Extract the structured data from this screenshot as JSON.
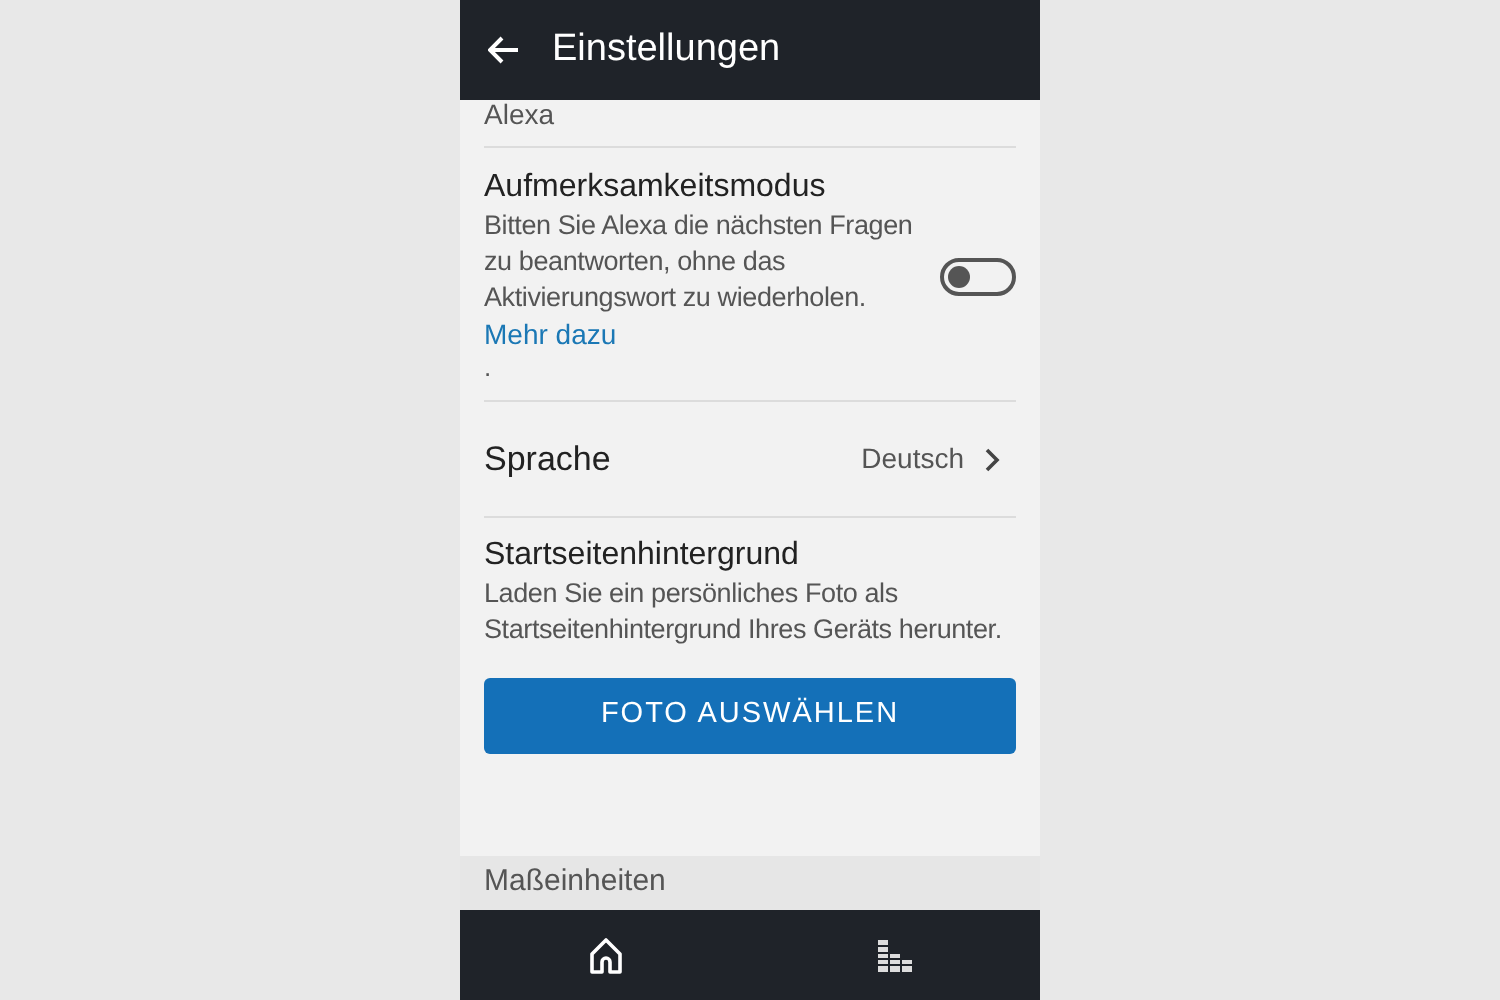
{
  "header": {
    "title": "Einstellungen"
  },
  "settings": [
    {
      "kind": "partial",
      "text": "Alexa"
    },
    {
      "kind": "toggle",
      "title": "Aufmerksamkeitsmodus",
      "description": "Bitten Sie Alexa die nächsten Fragen zu beantworten, ohne das Aktivierungswort zu wiederholen.",
      "link": "Mehr dazu",
      "note": ".",
      "on": false
    },
    {
      "kind": "select",
      "title": "Sprache",
      "value": "Deutsch"
    },
    {
      "kind": "action",
      "title": "Startseitenhintergrund",
      "description": "Laden Sie ein persönliches Foto als Startseitenhintergrund Ihres Geräts herunter.",
      "button": "FOTO AUSWÄHLEN"
    }
  ],
  "section_header": "Maßeinheiten"
}
